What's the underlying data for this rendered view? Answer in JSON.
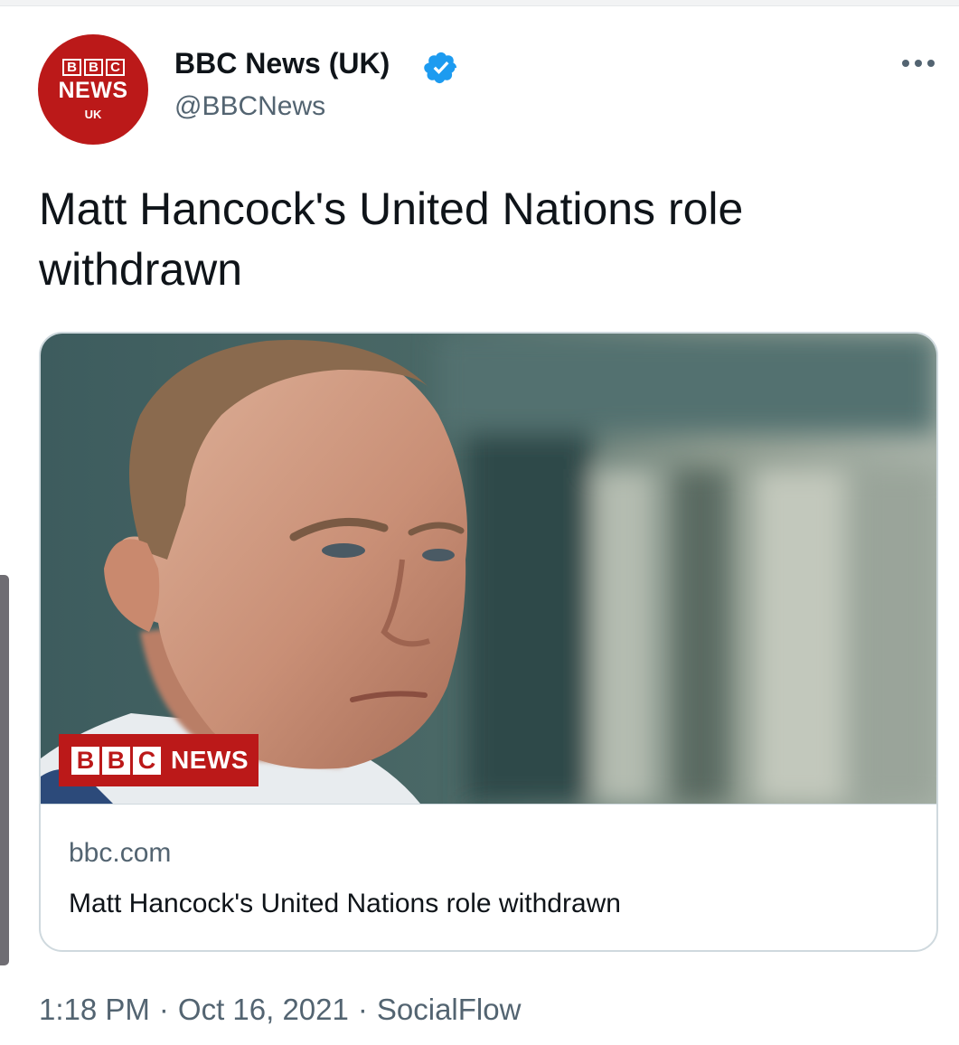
{
  "account": {
    "display_name": "BBC News (UK)",
    "handle": "@BBCNews",
    "verified": true,
    "avatar": {
      "blocks": [
        "B",
        "B",
        "C"
      ],
      "line1": "NEWS",
      "line2": "UK"
    }
  },
  "tweet": {
    "text": "Matt Hancock's United Nations role withdrawn"
  },
  "card": {
    "image": {
      "badge_blocks": [
        "B",
        "B",
        "C"
      ],
      "badge_word": "NEWS"
    },
    "domain": "bbc.com",
    "title": "Matt Hancock's United Nations role withdrawn"
  },
  "meta": {
    "time": "1:18 PM",
    "date": "Oct 16, 2021",
    "source": "SocialFlow",
    "separator": "·"
  },
  "icons": {
    "verified": "verified-badge-icon",
    "more": "more-dots-icon"
  },
  "colors": {
    "bbc_red": "#bb1919",
    "verified_blue": "#1d9bf0",
    "secondary_text": "#536471",
    "card_border": "#cfd9de"
  }
}
